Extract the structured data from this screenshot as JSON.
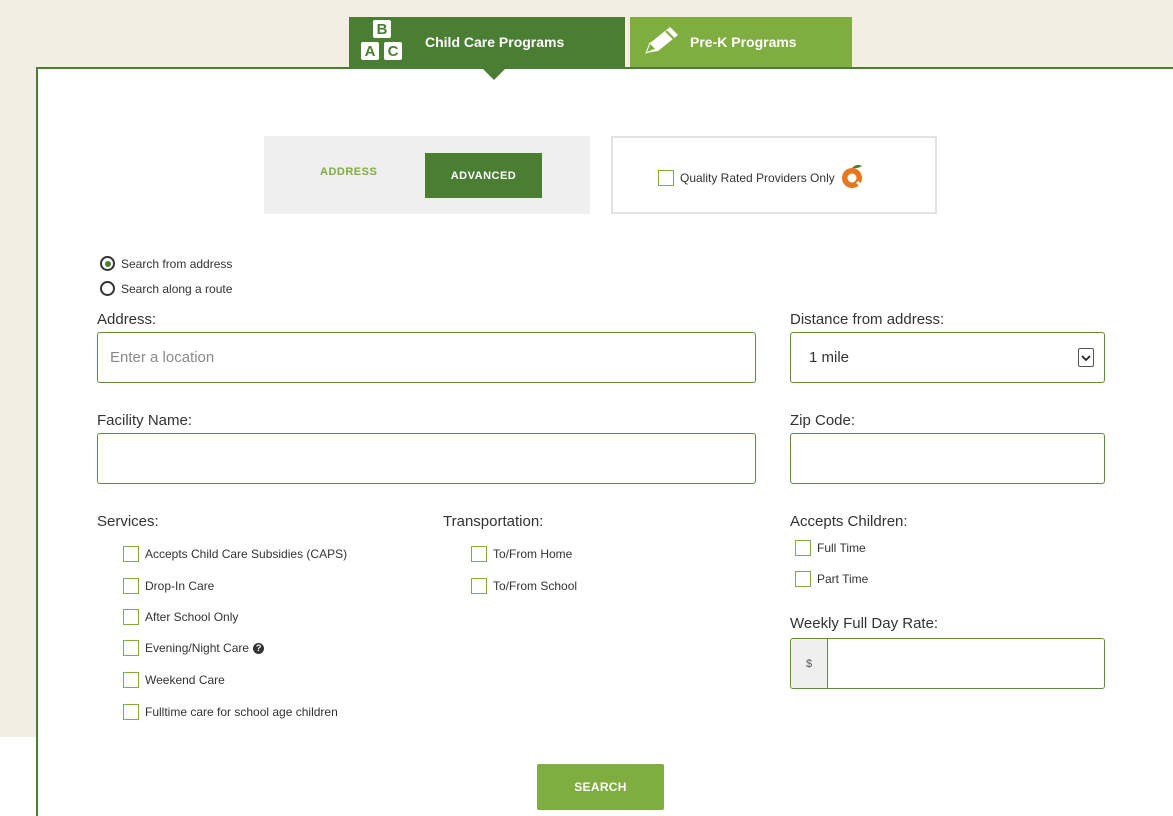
{
  "tabs": [
    {
      "label": "Child Care Programs",
      "icon": "abc-blocks-icon",
      "active": true
    },
    {
      "label": "Pre-K Programs",
      "icon": "pencil-icon",
      "active": false
    }
  ],
  "search_mode": {
    "address_label": "ADDRESS",
    "advanced_label": "ADVANCED",
    "selected": "ADVANCED"
  },
  "quality": {
    "label": "Quality Rated Providers Only",
    "icon": "quality-rated-logo-icon"
  },
  "search_type": {
    "from_address": "Search from address",
    "along_route": "Search along a route",
    "selected": "from_address"
  },
  "address": {
    "label": "Address:",
    "placeholder": "Enter a location",
    "value": ""
  },
  "distance": {
    "label": "Distance from address:",
    "value": "1 mile"
  },
  "facility": {
    "label": "Facility Name:",
    "value": ""
  },
  "zip": {
    "label": "Zip Code:",
    "value": ""
  },
  "services": {
    "label": "Services:",
    "items": [
      "Accepts Child Care Subsidies (CAPS)",
      "Drop-In Care",
      "After School Only",
      "Evening/Night Care",
      "Weekend Care",
      "Fulltime care for school age children"
    ]
  },
  "transportation": {
    "label": "Transportation:",
    "items": [
      "To/From Home",
      "To/From School"
    ]
  },
  "accepts_children": {
    "label": "Accepts Children:",
    "items": [
      "Full Time",
      "Part Time"
    ]
  },
  "rate": {
    "label": "Weekly Full Day Rate:",
    "prefix": "$",
    "value": ""
  },
  "search_button": "SEARCH",
  "colors": {
    "primary_green": "#4a7f33",
    "light_green": "#7fad3f",
    "page_bg": "#f4ede3",
    "quality_orange": "#e8761f"
  }
}
